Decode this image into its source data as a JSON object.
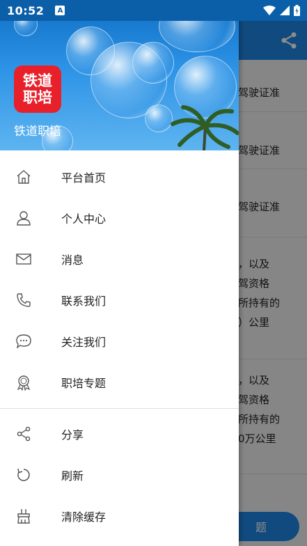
{
  "status_bar": {
    "time": "10:52",
    "badge": "A"
  },
  "drawer": {
    "app_name": "铁道职培",
    "logo_line1": "铁道",
    "logo_line2": "职培",
    "menu_primary": [
      {
        "label": "平台首页",
        "icon": "home-icon"
      },
      {
        "label": "个人中心",
        "icon": "user-icon"
      },
      {
        "label": "消息",
        "icon": "mail-icon"
      },
      {
        "label": "联系我们",
        "icon": "phone-icon"
      },
      {
        "label": "关注我们",
        "icon": "chat-icon"
      },
      {
        "label": "职培专题",
        "icon": "badge-icon"
      }
    ],
    "menu_secondary": [
      {
        "label": "分享",
        "icon": "share-icon"
      },
      {
        "label": "刷新",
        "icon": "refresh-icon"
      },
      {
        "label": "清除缓存",
        "icon": "broom-icon"
      }
    ]
  },
  "background": {
    "lines": [
      "驾驶证准",
      "驾驶证准",
      "驾驶证准",
      "，以及",
      "驾资格",
      "所持有的",
      "）公里",
      "，以及",
      "驾资格",
      "所持有的",
      "0万公里"
    ],
    "bottom_button": "题"
  }
}
